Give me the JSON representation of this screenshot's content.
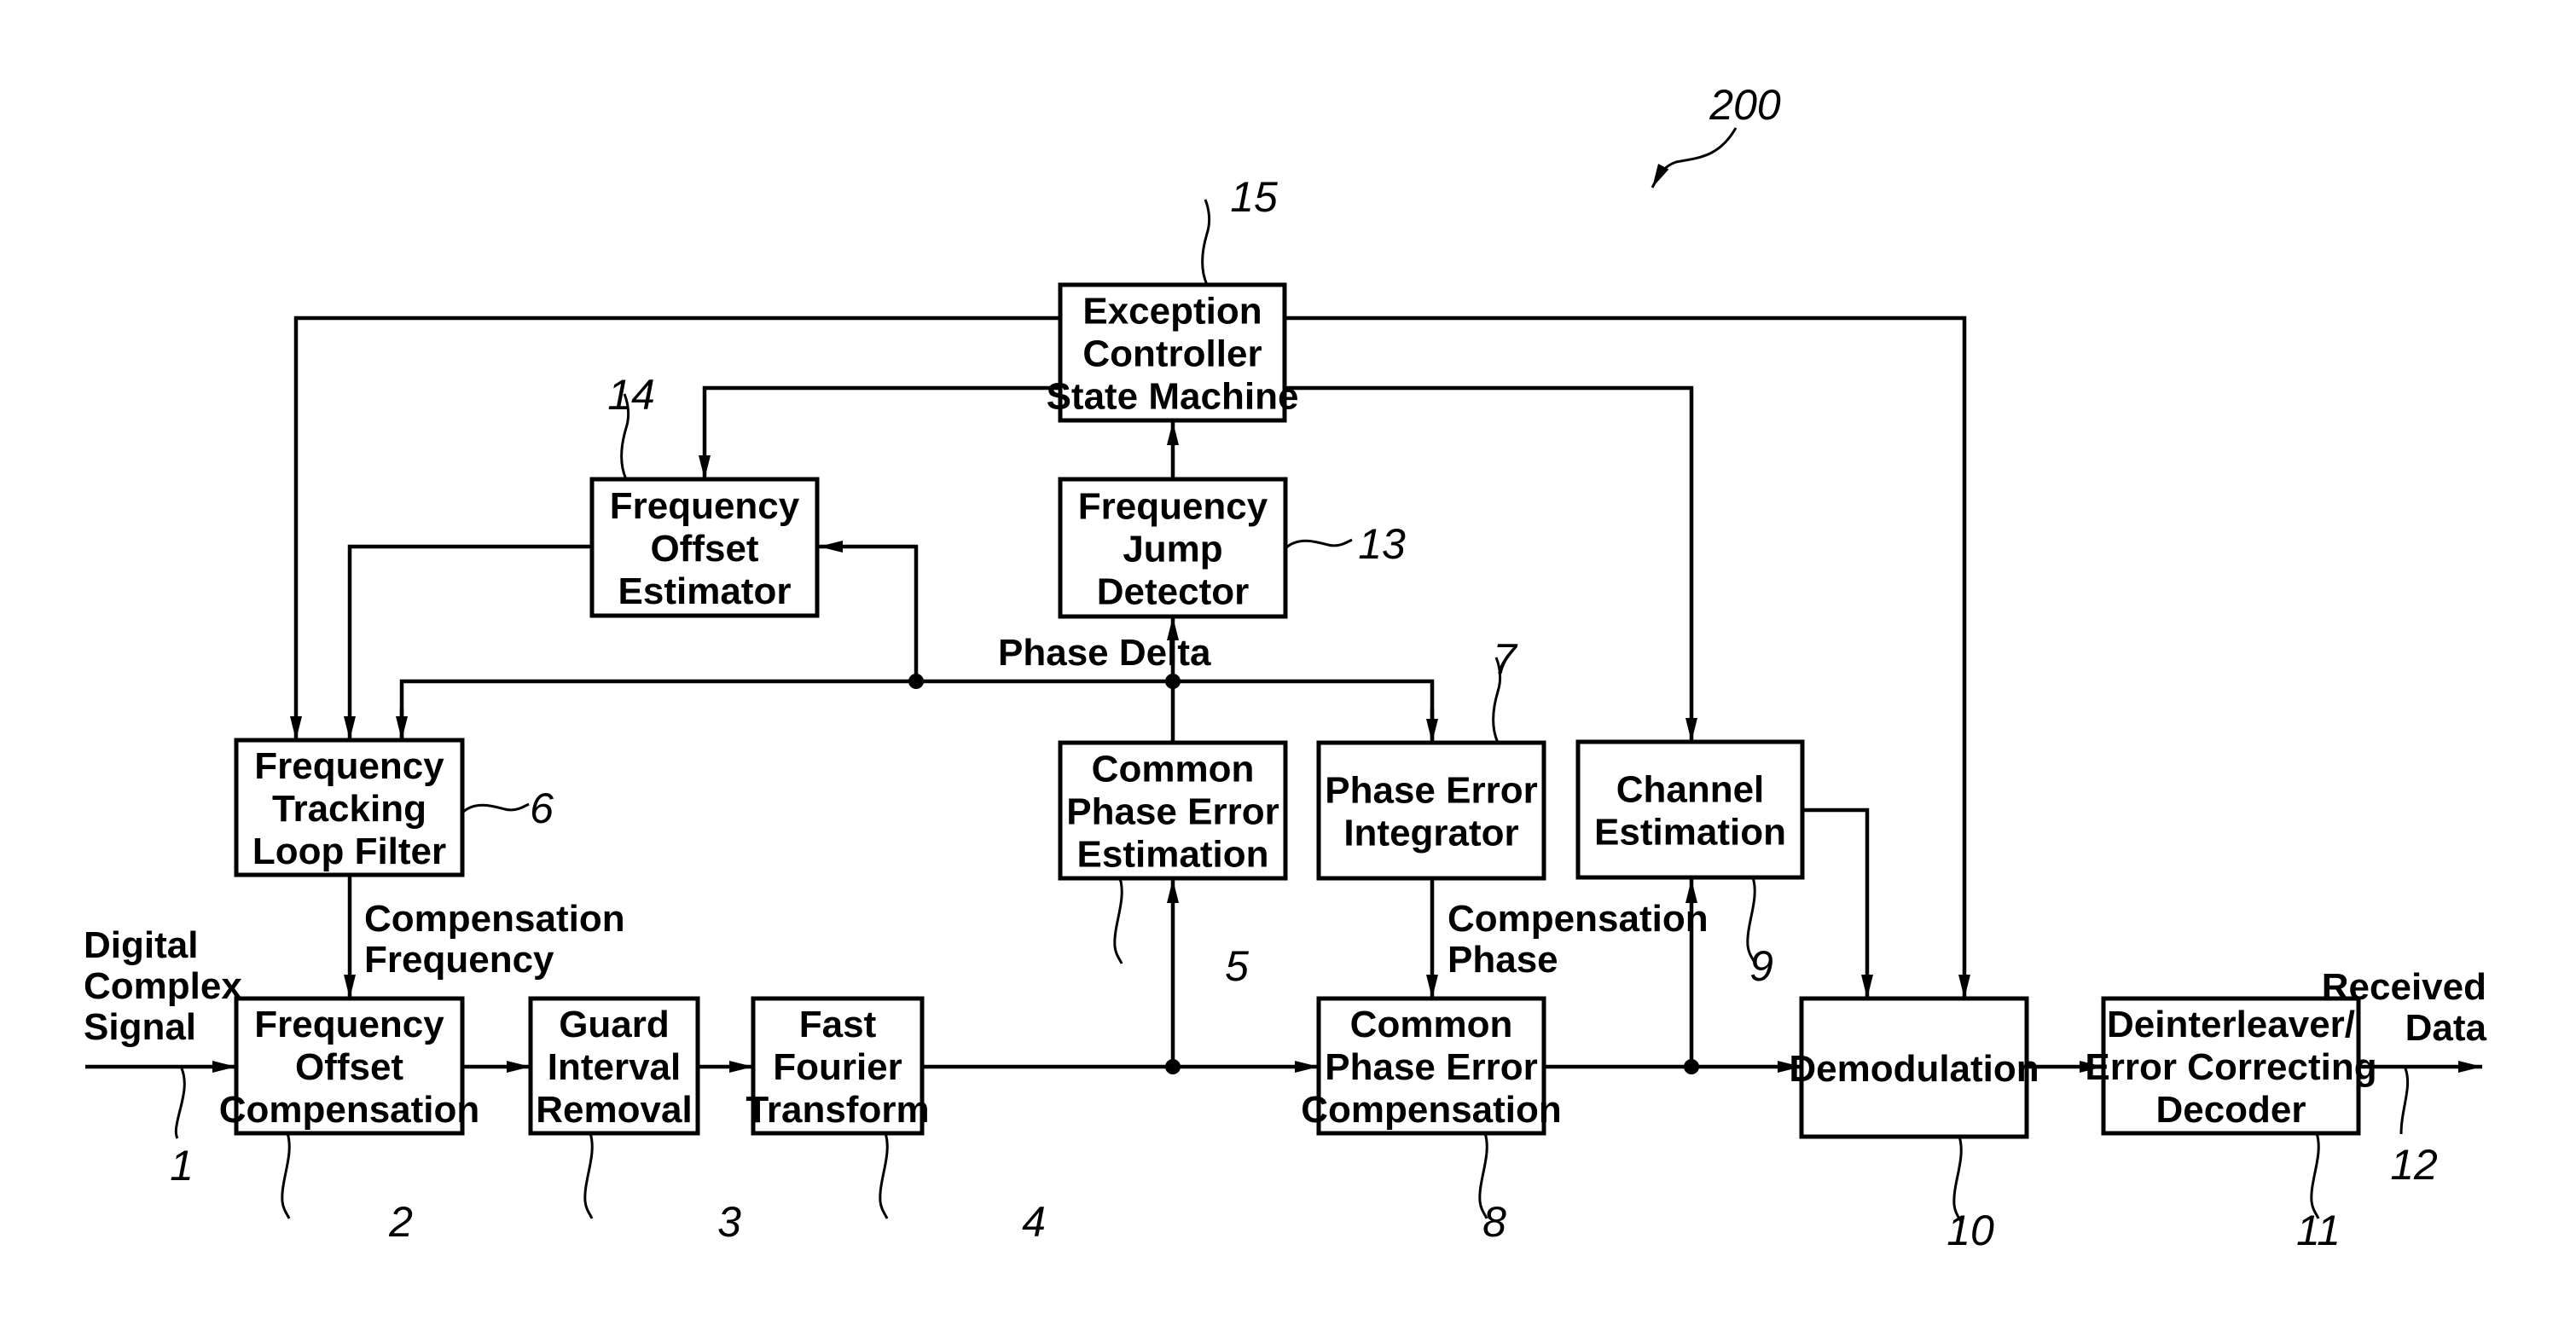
{
  "figure": {
    "reference_number": "200",
    "blocks": [
      {
        "id": "freq-offset-compensation",
        "ref": "2",
        "lines": [
          "Frequency",
          "Offset",
          "Compensation"
        ]
      },
      {
        "id": "guard-interval-removal",
        "ref": "3",
        "lines": [
          "Guard",
          "Interval",
          "Removal"
        ]
      },
      {
        "id": "fast-fourier-transform",
        "ref": "4",
        "lines": [
          "Fast",
          "Fourier",
          "Transform"
        ]
      },
      {
        "id": "common-phase-error-estimation",
        "ref": "5",
        "lines": [
          "Common",
          "Phase Error",
          "Estimation"
        ]
      },
      {
        "id": "frequency-tracking-loop-filter",
        "ref": "6",
        "lines": [
          "Frequency",
          "Tracking",
          "Loop Filter"
        ]
      },
      {
        "id": "phase-error-integrator",
        "ref": "7",
        "lines": [
          "Phase Error",
          "Integrator"
        ]
      },
      {
        "id": "common-phase-error-compensation",
        "ref": "8",
        "lines": [
          "Common",
          "Phase Error",
          "Compensation"
        ]
      },
      {
        "id": "channel-estimation",
        "ref": "9",
        "lines": [
          "Channel",
          "Estimation"
        ]
      },
      {
        "id": "demodulation",
        "ref": "10",
        "lines": [
          "Demodulation"
        ]
      },
      {
        "id": "deinterleaver-decoder",
        "ref": "11",
        "lines": [
          "Deinterleaver/",
          "Error Correcting",
          "Decoder"
        ]
      },
      {
        "id": "frequency-jump-detector",
        "ref": "13",
        "lines": [
          "Frequency",
          "Jump",
          "Detector"
        ]
      },
      {
        "id": "frequency-offset-estimator",
        "ref": "14",
        "lines": [
          "Frequency",
          "Offset",
          "Estimator"
        ]
      },
      {
        "id": "exception-controller",
        "ref": "15",
        "lines": [
          "Exception",
          "Controller",
          "State Machine"
        ]
      }
    ],
    "signal_labels": {
      "input": [
        "Digital",
        "Complex",
        "Signal"
      ],
      "input_ref": "1",
      "output": [
        "Received",
        "Data"
      ],
      "output_ref": "12",
      "compensation_frequency": [
        "Compensation",
        "Frequency"
      ],
      "compensation_phase": [
        "Compensation",
        "Phase"
      ],
      "phase_delta": "Phase Delta"
    }
  }
}
